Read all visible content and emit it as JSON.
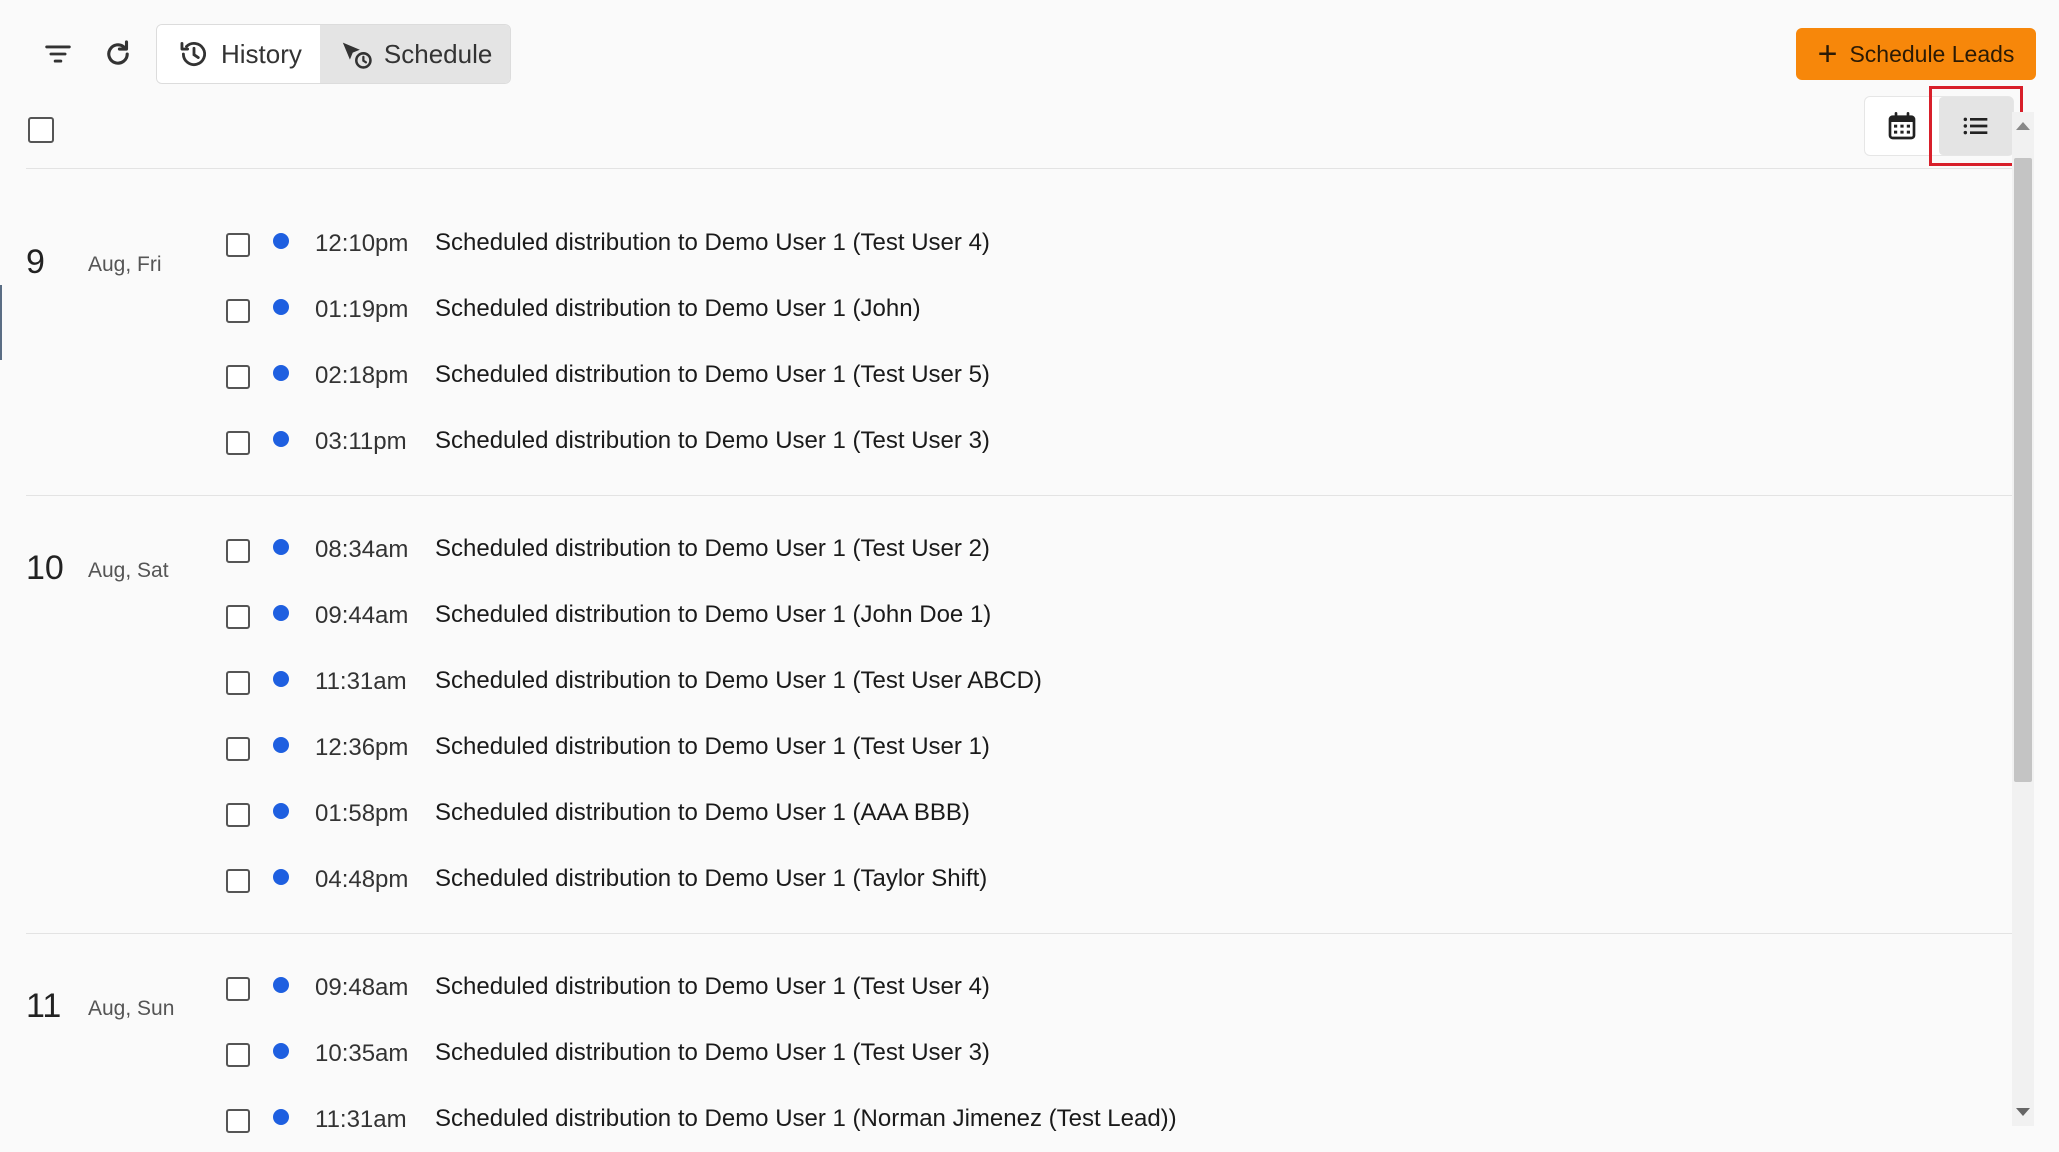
{
  "toolbar": {
    "filter_icon": "filter-icon",
    "refresh_icon": "refresh-icon",
    "tabs": [
      {
        "label": "History",
        "icon": "history-icon",
        "active": false
      },
      {
        "label": "Schedule",
        "icon": "schedule-icon",
        "active": true
      }
    ],
    "primary_button": {
      "label": "Schedule Leads",
      "icon": "plus-icon",
      "color": "#f7870a"
    }
  },
  "view_switch": {
    "calendar_icon": "calendar-icon",
    "list_icon": "list-icon",
    "active": "list"
  },
  "colors": {
    "accent": "#f7870a",
    "status_dot": "#1e5fe0",
    "highlight_box": "#d81f2a"
  },
  "days": [
    {
      "day": "9",
      "label": "Aug, Fri",
      "entries": [
        {
          "time": "12:10pm",
          "title": "Scheduled distribution to Demo User 1 (Test User 4)"
        },
        {
          "time": "01:19pm",
          "title": "Scheduled distribution to Demo User 1 (John)"
        },
        {
          "time": "02:18pm",
          "title": "Scheduled distribution to Demo User 1 (Test User 5)"
        },
        {
          "time": "03:11pm",
          "title": "Scheduled distribution to Demo User 1 (Test User 3)"
        }
      ]
    },
    {
      "day": "10",
      "label": "Aug, Sat",
      "entries": [
        {
          "time": "08:34am",
          "title": "Scheduled distribution to Demo User 1 (Test User 2)"
        },
        {
          "time": "09:44am",
          "title": "Scheduled distribution to Demo User 1 (John Doe 1)"
        },
        {
          "time": "11:31am",
          "title": "Scheduled distribution to Demo User 1 (Test User ABCD)"
        },
        {
          "time": "12:36pm",
          "title": "Scheduled distribution to Demo User 1 (Test User 1)"
        },
        {
          "time": "01:58pm",
          "title": "Scheduled distribution to Demo User 1 (AAA BBB)"
        },
        {
          "time": "04:48pm",
          "title": "Scheduled distribution to Demo User 1 (Taylor Shift)"
        }
      ]
    },
    {
      "day": "11",
      "label": "Aug, Sun",
      "entries": [
        {
          "time": "09:48am",
          "title": "Scheduled distribution to Demo User 1 (Test User 4)"
        },
        {
          "time": "10:35am",
          "title": "Scheduled distribution to Demo User 1 (Test User 3)"
        },
        {
          "time": "11:31am",
          "title": "Scheduled distribution to Demo User 1 (Norman Jimenez (Test Lead))"
        }
      ]
    }
  ]
}
